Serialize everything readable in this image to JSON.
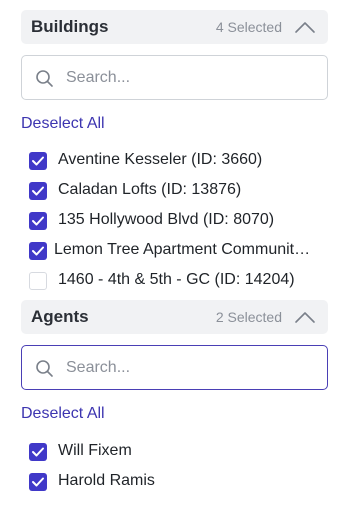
{
  "buildings": {
    "title": "Buildings",
    "selected_count": "4 Selected",
    "search_placeholder": "Search...",
    "search_value": "",
    "deselect_label": "Deselect All",
    "options": [
      {
        "label": "Aventine Kesseler (ID: 3660)",
        "checked": true
      },
      {
        "label": "Caladan Lofts (ID: 13876)",
        "checked": true
      },
      {
        "label": "135 Hollywood Blvd (ID: 8070)",
        "checked": true
      },
      {
        "label": "Lemon Tree Apartment Communit…",
        "checked": true
      },
      {
        "label": "1460 - 4th & 5th - GC (ID: 14204)",
        "checked": false
      }
    ]
  },
  "agents": {
    "title": "Agents",
    "selected_count": "2 Selected",
    "search_placeholder": "Search...",
    "search_value": "",
    "deselect_label": "Deselect All",
    "options": [
      {
        "label": "Will Fixem",
        "checked": true
      },
      {
        "label": "Harold Ramis",
        "checked": true
      }
    ]
  },
  "colors": {
    "accent": "#4038c8",
    "link": "#3d35b0",
    "header_bg": "#f1f2f4",
    "focus_border": "#4a3fb5"
  },
  "icons": {
    "search": "search-icon",
    "collapse": "chevron-up-icon",
    "check": "checkmark-icon"
  }
}
